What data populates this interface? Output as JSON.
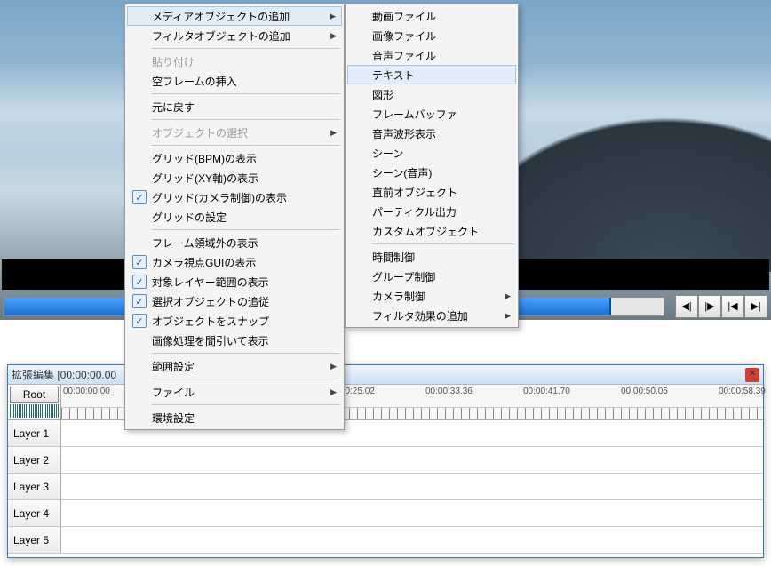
{
  "transport": {
    "prev": "◀|",
    "play": "|▶",
    "first": "|◀",
    "last": "▶|"
  },
  "timeline": {
    "title": "拡張編集 [00:00:00.00",
    "root": "Root",
    "ticks": [
      "00:00:00.00",
      "00:00:25.02",
      "00:00:33.36",
      "00:00:41.70",
      "00:00:50.05",
      "00:00:58.39"
    ],
    "layers": [
      "Layer 1",
      "Layer 2",
      "Layer 3",
      "Layer 4",
      "Layer 5"
    ]
  },
  "menu1": {
    "items": [
      {
        "label": "メディアオブジェクトの追加",
        "arrow": true,
        "highlight": true
      },
      {
        "label": "フィルタオブジェクトの追加",
        "arrow": true
      },
      {
        "sep": true
      },
      {
        "label": "貼り付け",
        "disabled": true
      },
      {
        "label": "空フレームの挿入"
      },
      {
        "sep": true
      },
      {
        "label": "元に戻す"
      },
      {
        "sep": true
      },
      {
        "label": "オブジェクトの選択",
        "arrow": true,
        "disabled": true
      },
      {
        "sep": true
      },
      {
        "label": "グリッド(BPM)の表示"
      },
      {
        "label": "グリッド(XY軸)の表示"
      },
      {
        "label": "グリッド(カメラ制御)の表示",
        "checked": true
      },
      {
        "label": "グリッドの設定"
      },
      {
        "sep": true
      },
      {
        "label": "フレーム領域外の表示"
      },
      {
        "label": "カメラ視点GUIの表示",
        "checked": true
      },
      {
        "label": "対象レイヤー範囲の表示",
        "checked": true
      },
      {
        "label": "選択オブジェクトの追従",
        "checked": true
      },
      {
        "label": "オブジェクトをスナップ",
        "checked": true
      },
      {
        "label": "画像処理を間引いて表示"
      },
      {
        "sep": true
      },
      {
        "label": "範囲設定",
        "arrow": true
      },
      {
        "sep": true
      },
      {
        "label": "ファイル",
        "arrow": true
      },
      {
        "sep": true
      },
      {
        "label": "環境設定"
      }
    ]
  },
  "menu2": {
    "items": [
      {
        "label": "動画ファイル"
      },
      {
        "label": "画像ファイル"
      },
      {
        "label": "音声ファイル"
      },
      {
        "label": "テキスト",
        "highlight": true
      },
      {
        "label": "図形"
      },
      {
        "label": "フレームバッファ"
      },
      {
        "label": "音声波形表示"
      },
      {
        "label": "シーン"
      },
      {
        "label": "シーン(音声)"
      },
      {
        "label": "直前オブジェクト"
      },
      {
        "label": "パーティクル出力"
      },
      {
        "label": "カスタムオブジェクト"
      },
      {
        "sep": true
      },
      {
        "label": "時間制御"
      },
      {
        "label": "グループ制御"
      },
      {
        "label": "カメラ制御",
        "arrow": true
      },
      {
        "label": "フィルタ効果の追加",
        "arrow": true
      }
    ]
  }
}
